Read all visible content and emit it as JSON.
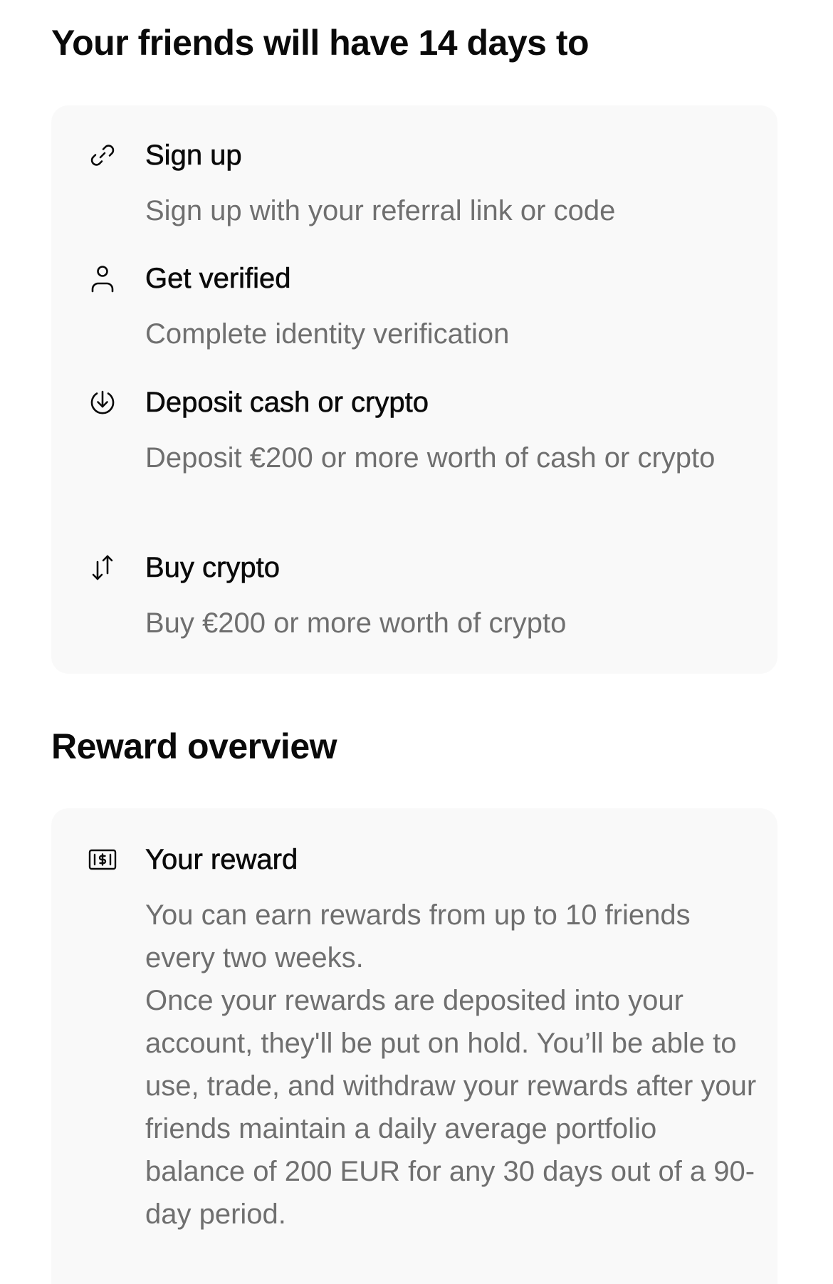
{
  "steps_section": {
    "title": "Your friends will have 14 days to",
    "items": [
      {
        "icon": "link-icon",
        "title": "Sign up",
        "description": "Sign up with your referral link or code"
      },
      {
        "icon": "user-icon",
        "title": "Get verified",
        "description": "Complete identity verification"
      },
      {
        "icon": "deposit-arrow-icon",
        "title": "Deposit cash or crypto",
        "description": "Deposit €200 or more worth of cash or crypto"
      },
      {
        "icon": "swap-arrows-icon",
        "title": "Buy crypto",
        "description": "Buy €200 or more worth of crypto"
      }
    ]
  },
  "reward_section": {
    "title": "Reward overview",
    "item": {
      "icon": "banknote-icon",
      "title": "Your reward",
      "paragraph_1": "You can earn rewards from up to 10 friends every two weeks.",
      "paragraph_2": "Once your rewards are deposited into your account, they'll be put on hold. You’ll be able to use, trade, and withdraw your rewards after your friends maintain a daily average portfolio balance of 200 EUR for any 30 days out of a 90-day period."
    }
  },
  "colors": {
    "text_primary": "#0a0a0a",
    "text_secondary": "#6f6f6f",
    "card_background": "#f9f9f9",
    "page_background": "#ffffff"
  }
}
